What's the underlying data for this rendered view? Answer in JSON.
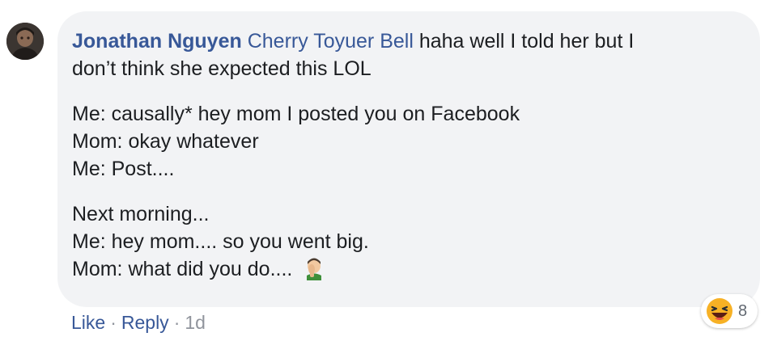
{
  "comment": {
    "author": "Jonathan Nguyen",
    "mention": "Cherry Toyuer Bell",
    "line1_rest": " haha well I told her but I",
    "line2": "don’t think she expected this LOL",
    "line3": "Me: causally* hey mom I posted you on Facebook",
    "line4": "Mom: okay whatever",
    "line5": "Me: Post....",
    "line6": "Next morning...",
    "line7": "Me: hey mom.... so you went big.",
    "line8": "Mom: what did you do....",
    "inline_emoji": "face-palm-emoji"
  },
  "reactions": {
    "icon": "haha-reaction-icon",
    "count": "8"
  },
  "actions": {
    "like": "Like",
    "reply": "Reply",
    "separator": "·",
    "time": "1d"
  },
  "colors": {
    "bubble": "#f2f3f5",
    "link": "#385898",
    "meta": "#90949c",
    "text": "#1c1e21"
  }
}
